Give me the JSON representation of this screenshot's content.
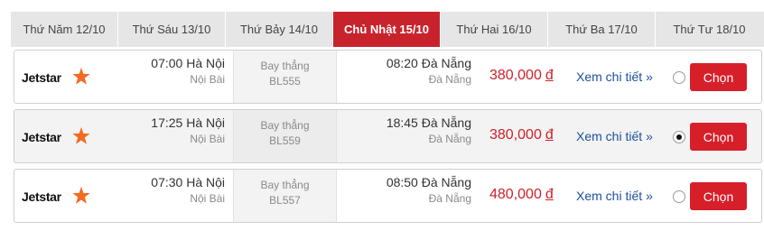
{
  "tabs": [
    {
      "label": "Thứ Năm 12/10",
      "active": false
    },
    {
      "label": "Thứ Sáu 13/10",
      "active": false
    },
    {
      "label": "Thứ Bảy 14/10",
      "active": false
    },
    {
      "label": "Chủ Nhật 15/10",
      "active": true
    },
    {
      "label": "Thứ Hai 16/10",
      "active": false
    },
    {
      "label": "Thứ Ba 17/10",
      "active": false
    },
    {
      "label": "Thứ Tư 18/10",
      "active": false
    }
  ],
  "colors": {
    "accent": "#c8232c",
    "price": "#d0202a",
    "link": "#1c4f9c",
    "logo_star": "#f26b21"
  },
  "flights": [
    {
      "airline_logo_text": "Jetstar",
      "dep_time_city": "07:00 Hà Nội",
      "dep_airport": "Nội Bài",
      "flight_type": "Bay thẳng",
      "flight_no": "BL555",
      "arr_time_city": "08:20 Đà Nẵng",
      "arr_airport": "Đà Nẵng",
      "price": "380,000",
      "currency": "đ",
      "detail_label": "Xem chi tiết",
      "detail_chevron": "»",
      "selected": false,
      "choose_label": "Chọn"
    },
    {
      "airline_logo_text": "Jetstar",
      "dep_time_city": "17:25 Hà Nội",
      "dep_airport": "Nội Bài",
      "flight_type": "Bay thẳng",
      "flight_no": "BL559",
      "arr_time_city": "18:45 Đà Nẵng",
      "arr_airport": "Đà Nẵng",
      "price": "380,000",
      "currency": "đ",
      "detail_label": "Xem chi tiết",
      "detail_chevron": "»",
      "selected": true,
      "choose_label": "Chọn"
    },
    {
      "airline_logo_text": "Jetstar",
      "dep_time_city": "07:30 Hà Nội",
      "dep_airport": "Nội Bài",
      "flight_type": "Bay thẳng",
      "flight_no": "BL557",
      "arr_time_city": "08:50 Đà Nẵng",
      "arr_airport": "Đà Nẵng",
      "price": "480,000",
      "currency": "đ",
      "detail_label": "Xem chi tiết",
      "detail_chevron": "»",
      "selected": false,
      "choose_label": "Chọn"
    }
  ]
}
